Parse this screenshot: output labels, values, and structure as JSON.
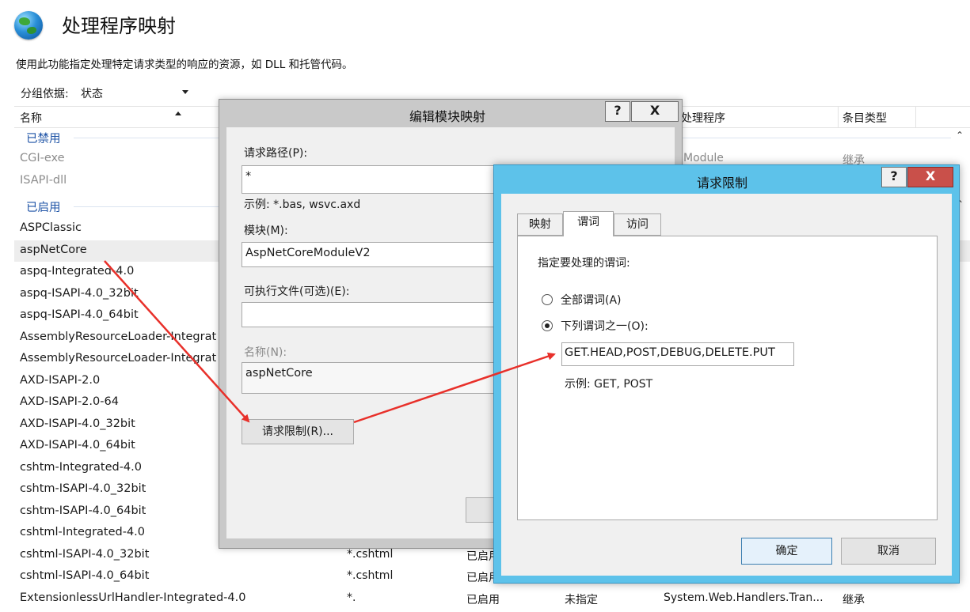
{
  "header": {
    "title": "处理程序映射",
    "description": "使用此功能指定处理特定请求类型的响应的资源，如 DLL 和托管代码。"
  },
  "group_by": {
    "label": "分组依据:",
    "value": "状态"
  },
  "columns": [
    "名称",
    "",
    "",
    "",
    "处理程序",
    "条目类型"
  ],
  "groups": {
    "disabled": "已禁用",
    "enabled": "已启用"
  },
  "rows_disabled": [
    {
      "name": "CGI-exe",
      "handler": "Module",
      "type": "继承"
    },
    {
      "name": "ISAPI-dll",
      "handler": "",
      "type": ""
    }
  ],
  "rows_enabled": [
    {
      "name": "ASPClassic",
      "path": "",
      "state": "",
      "path_type": "",
      "handler": "",
      "type": ""
    },
    {
      "name": "aspNetCore",
      "path": "",
      "state": "",
      "path_type": "",
      "handler": "",
      "type": ""
    },
    {
      "name": "aspq-Integrated-4.0",
      "path": "",
      "state": "",
      "path_type": "",
      "handler": "",
      "type": ""
    },
    {
      "name": "aspq-ISAPI-4.0_32bit",
      "path": "",
      "state": "",
      "path_type": "",
      "handler": "",
      "type": ""
    },
    {
      "name": "aspq-ISAPI-4.0_64bit",
      "path": "",
      "state": "",
      "path_type": "",
      "handler": "",
      "type": ""
    },
    {
      "name": "AssemblyResourceLoader-Integrat",
      "path": "",
      "state": "",
      "path_type": "",
      "handler": "",
      "type": ""
    },
    {
      "name": "AssemblyResourceLoader-Integrat",
      "path": "",
      "state": "",
      "path_type": "",
      "handler": "",
      "type": ""
    },
    {
      "name": "AXD-ISAPI-2.0",
      "path": "",
      "state": "",
      "path_type": "",
      "handler": "",
      "type": ""
    },
    {
      "name": "AXD-ISAPI-2.0-64",
      "path": "",
      "state": "",
      "path_type": "",
      "handler": "",
      "type": ""
    },
    {
      "name": "AXD-ISAPI-4.0_32bit",
      "path": "",
      "state": "",
      "path_type": "",
      "handler": "",
      "type": ""
    },
    {
      "name": "AXD-ISAPI-4.0_64bit",
      "path": "",
      "state": "",
      "path_type": "",
      "handler": "",
      "type": ""
    },
    {
      "name": "cshtm-Integrated-4.0",
      "path": "",
      "state": "",
      "path_type": "",
      "handler": "",
      "type": ""
    },
    {
      "name": "cshtm-ISAPI-4.0_32bit",
      "path": "",
      "state": "",
      "path_type": "",
      "handler": "",
      "type": ""
    },
    {
      "name": "cshtm-ISAPI-4.0_64bit",
      "path": "",
      "state": "",
      "path_type": "",
      "handler": "",
      "type": ""
    },
    {
      "name": "cshtml-Integrated-4.0",
      "path": "",
      "state": "",
      "path_type": "",
      "handler": "",
      "type": ""
    },
    {
      "name": "cshtml-ISAPI-4.0_32bit",
      "path": "*.cshtml",
      "state": "已启用",
      "path_type": "",
      "handler": "",
      "type": ""
    },
    {
      "name": "cshtml-ISAPI-4.0_64bit",
      "path": "*.cshtml",
      "state": "已启用",
      "path_type": "",
      "handler": "",
      "type": ""
    },
    {
      "name": "ExtensionlessUrlHandler-Integrated-4.0",
      "path": "*.",
      "state": "已启用",
      "path_type": "未指定",
      "handler": "System.Web.Handlers.Tran...",
      "type": "继承"
    }
  ],
  "edit_dialog": {
    "title": "编辑模块映射",
    "help": "?",
    "close": "X",
    "request_path_label": "请求路径(P):",
    "request_path_value": "*",
    "example": "示例: *.bas, wsvc.axd",
    "module_label": "模块(M):",
    "module_value": "AspNetCoreModuleV2",
    "executable_label": "可执行文件(可选)(E):",
    "executable_value": "",
    "name_label": "名称(N):",
    "name_value": "aspNetCore",
    "restrictions_button": "请求限制(R)...",
    "ok_button": ""
  },
  "restrict_dialog": {
    "title": "请求限制",
    "help": "?",
    "close": "X",
    "tabs": [
      "映射",
      "谓词",
      "访问"
    ],
    "instruction": "指定要处理的谓词:",
    "option_all": "全部谓词(A)",
    "option_one_of": "下列谓词之一(O):",
    "verbs_value": "GET.HEAD,POST,DEBUG,DELETE.PUT",
    "example": "示例: GET, POST",
    "ok": "确定",
    "cancel": "取消"
  },
  "colors": {
    "dialog_accent": "#5dc2ea",
    "arrow": "#e8302a",
    "group_text": "#1e53a6"
  }
}
